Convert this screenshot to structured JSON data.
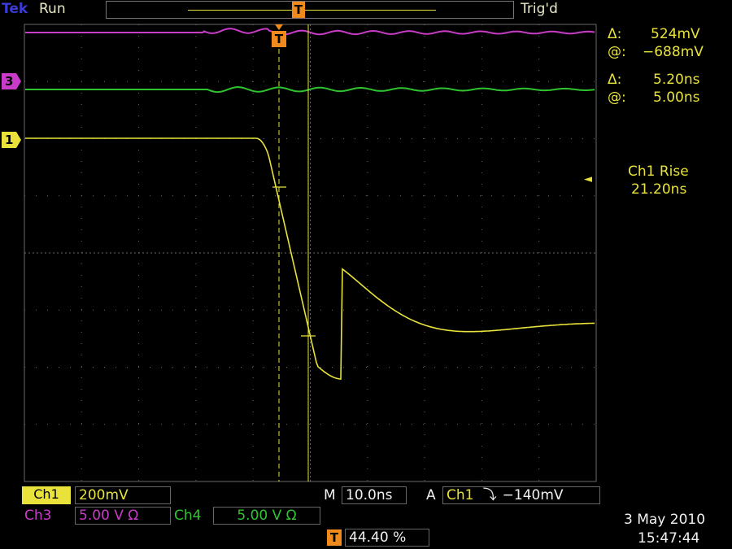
{
  "header": {
    "brand": "Tek",
    "mode": "Run",
    "trigger_status": "Trig'd",
    "trigger_pos_marker": "T"
  },
  "markers": {
    "ch3": "3",
    "ch1": "1",
    "trigger": "T"
  },
  "cursor_readout": {
    "v_delta_sym": "Δ:",
    "v_delta": "524mV",
    "v_at_sym": "@:",
    "v_at": "−688mV",
    "t_delta_sym": "Δ:",
    "t_delta": "5.20ns",
    "t_at_sym": "@:",
    "t_at": "5.00ns"
  },
  "measurement": {
    "name": "Ch1 Rise",
    "value": "21.20ns",
    "pointer": "◄"
  },
  "bottom": {
    "ch1_label": "Ch1",
    "ch1_scale": "200mV",
    "ch3_label": "Ch3",
    "ch3_scale": "5.00 V Ω",
    "ch4_label": "Ch4",
    "ch4_scale": "5.00 V Ω",
    "timebase_prefix": "M",
    "timebase": "10.0ns",
    "trigger_prefix": "A",
    "trigger_source": "Ch1",
    "trigger_slope": "⤵",
    "trigger_level": "−140mV",
    "trigger_pos_icon": "T",
    "trigger_pos": "44.40 %",
    "date": "3 May 2010",
    "time": "15:47:44"
  },
  "colors": {
    "ch1": "#e8e23a",
    "ch3": "#c83cc8",
    "ch4": "#2fc42f",
    "trigger": "#f08a1c",
    "grid": "#6a6a6a"
  }
}
